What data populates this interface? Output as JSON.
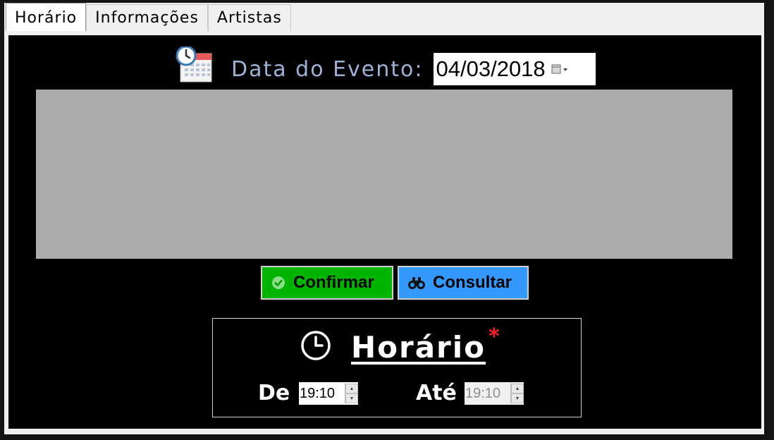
{
  "tabs": [
    {
      "label": "Horário",
      "active": true
    },
    {
      "label": "Informações",
      "active": false
    },
    {
      "label": "Artistas",
      "active": false
    }
  ],
  "event_date": {
    "label": "Data do Evento:",
    "value": "04/03/2018",
    "icon": "calendar-clock-icon"
  },
  "buttons": {
    "confirm_label": "Confirmar",
    "confirm_icon": "check-circle-icon",
    "consult_label": "Consultar",
    "consult_icon": "binoculars-icon"
  },
  "schedule": {
    "title": "Horário",
    "required_mark": "*",
    "icon": "clock-icon",
    "from_label": "De",
    "from_value": "19:10",
    "to_label": "Até",
    "to_value": "19:10",
    "to_enabled": false
  },
  "colors": {
    "panel_bg": "#000000",
    "label_blue": "#9db2d6",
    "confirm_green": "#00b400",
    "consult_blue": "#3399ff",
    "grid_gray": "#ababab",
    "required_red": "#ff2020"
  }
}
